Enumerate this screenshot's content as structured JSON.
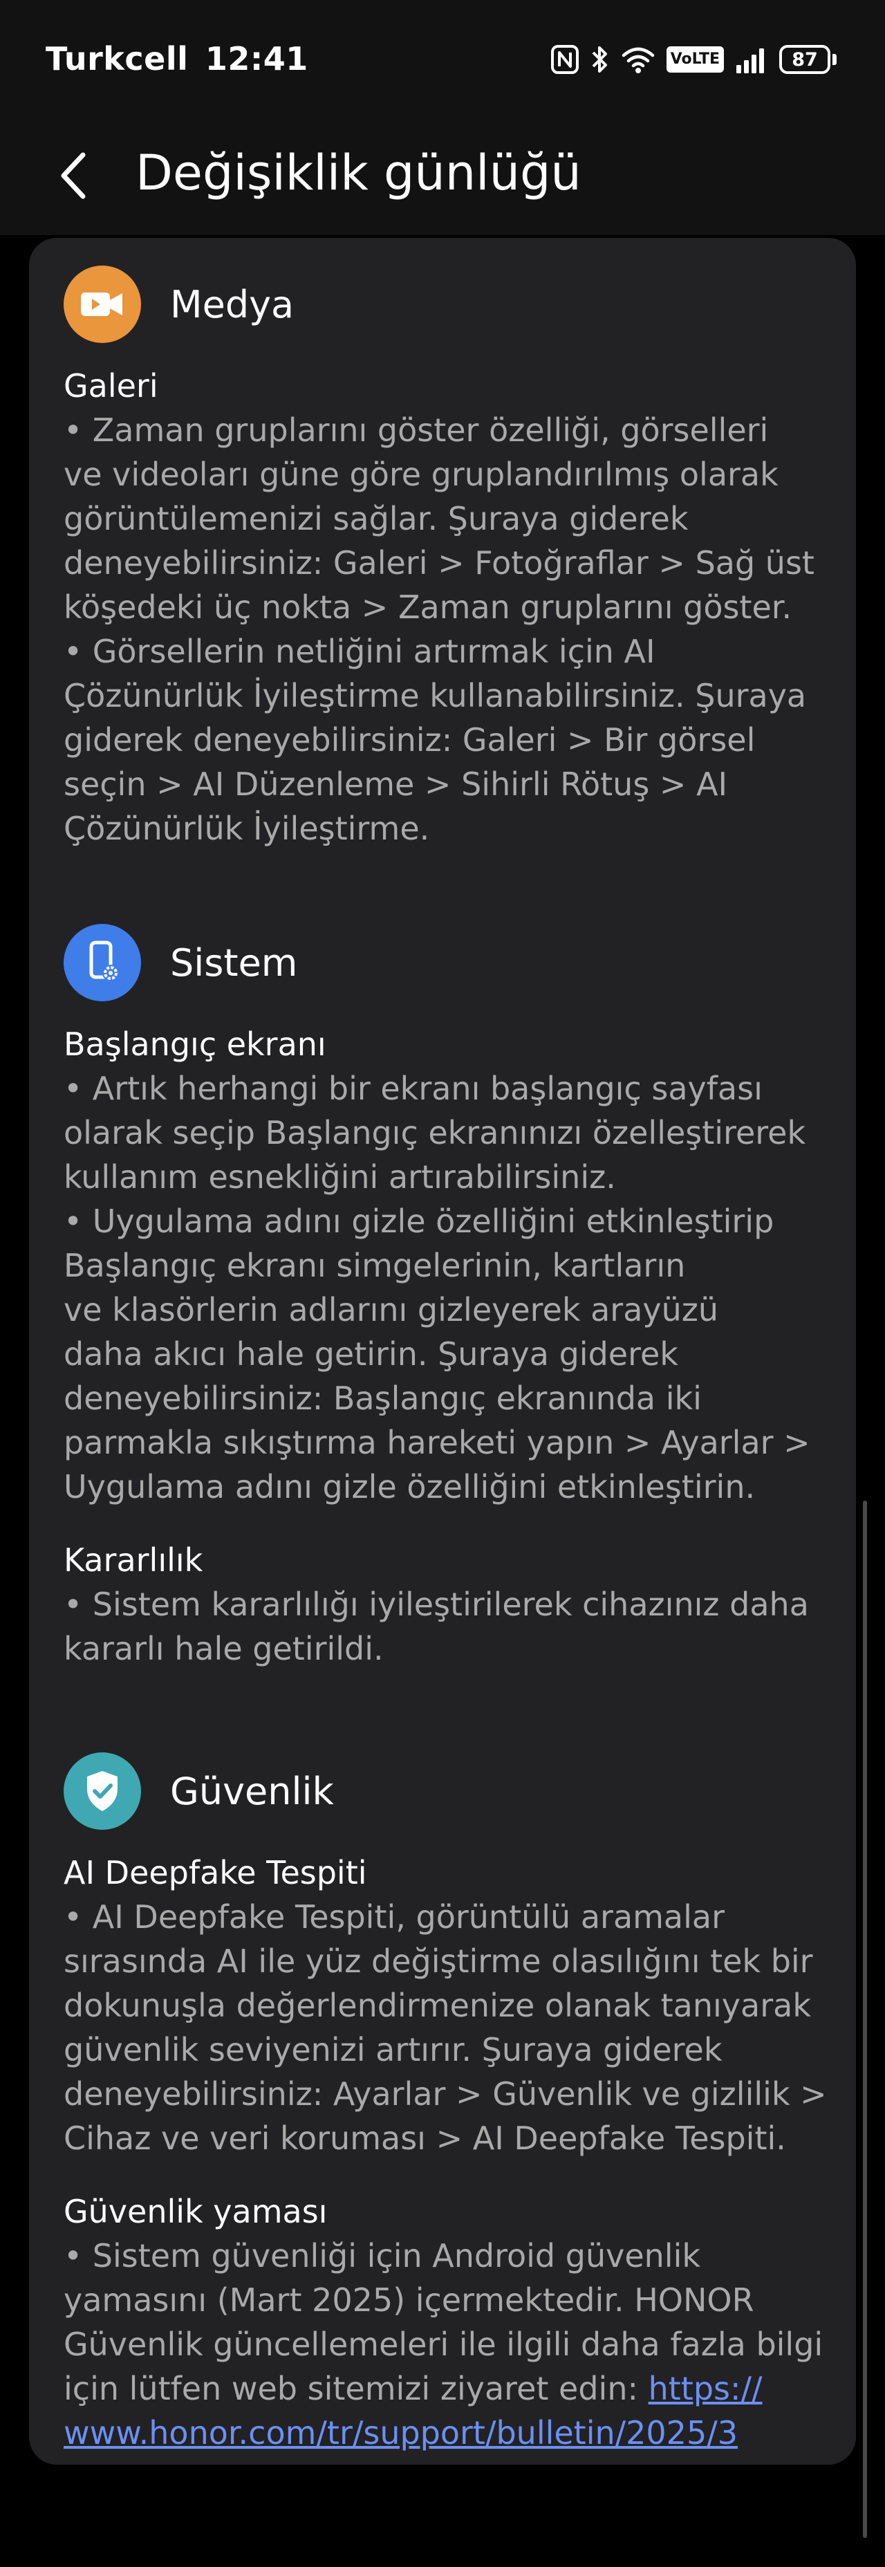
{
  "status_bar": {
    "carrier": "Turkcell",
    "time": "12:41",
    "volte": "VoLTE",
    "battery": "87"
  },
  "header": {
    "title": "Değişiklik günlüğü"
  },
  "colors": {
    "media_icon_bg": "#e9963c",
    "system_icon_bg": "#3f7de9",
    "security_icon_bg": "#3fa8b3",
    "link": "#6c8ff2"
  },
  "sections": [
    {
      "title": "Medya",
      "icon": "video-camera-icon",
      "groups": [
        {
          "subtitle": "Galeri",
          "lines": [
            "• Zaman gruplarını göster özelliği, görselleri",
            "ve videoları güne göre gruplandırılmış olarak",
            "görüntülemenizi sağlar. Şuraya giderek",
            "deneyebilirsiniz: Galeri > Fotoğraflar > Sağ üst",
            "köşedeki üç nokta > Zaman gruplarını göster.",
            "• Görsellerin netliğini artırmak için AI",
            "Çözünürlük İyileştirme kullanabilirsiniz. Şuraya",
            "giderek deneyebilirsiniz: Galeri > Bir görsel",
            "seçin > AI Düzenleme > Sihirli Rötuş > AI",
            "Çözünürlük İyileştirme."
          ]
        }
      ]
    },
    {
      "title": "Sistem",
      "icon": "phone-settings-icon",
      "groups": [
        {
          "subtitle": "Başlangıç ekranı",
          "lines": [
            "• Artık herhangi bir ekranı başlangıç sayfası",
            "olarak seçip Başlangıç ekranınızı özelleştirerek",
            "kullanım esnekliğini artırabilirsiniz.",
            "• Uygulama adını gizle özelliğini etkinleştirip",
            "Başlangıç ekranı simgelerinin, kartların",
            "ve klasörlerin adlarını gizleyerek arayüzü",
            "daha akıcı hale getirin. Şuraya giderek",
            "deneyebilirsiniz: Başlangıç ekranında iki",
            "parmakla sıkıştırma hareketi yapın > Ayarlar >",
            "Uygulama adını gizle özelliğini etkinleştirin."
          ]
        },
        {
          "subtitle": "Kararlılık",
          "lines": [
            "• Sistem kararlılığı iyileştirilerek cihazınız daha",
            "kararlı hale getirildi."
          ]
        }
      ]
    },
    {
      "title": "Güvenlik",
      "icon": "shield-check-icon",
      "groups": [
        {
          "subtitle": "AI Deepfake Tespiti",
          "lines": [
            "• AI Deepfake Tespiti, görüntülü aramalar",
            "sırasında AI ile yüz değiştirme olasılığını tek bir",
            "dokunuşla değerlendirmenize olanak tanıyarak",
            "güvenlik seviyenizi artırır. Şuraya giderek",
            "deneyebilirsiniz: Ayarlar > Güvenlik ve gizlilik >",
            "Cihaz ve veri koruması > AI Deepfake Tespiti."
          ]
        },
        {
          "subtitle": "Güvenlik yaması",
          "lines": [
            "• Sistem güvenliği için Android güvenlik",
            "yamasını (Mart 2025) içermektedir. HONOR",
            "Güvenlik güncellemeleri ile ilgili daha fazla bilgi"
          ],
          "link_prefix": "için lütfen web sitemizi ziyaret edin: ",
          "link_part1": "https://",
          "link_part2": "www.honor.com/tr/support/bulletin/2025/3"
        }
      ]
    }
  ]
}
